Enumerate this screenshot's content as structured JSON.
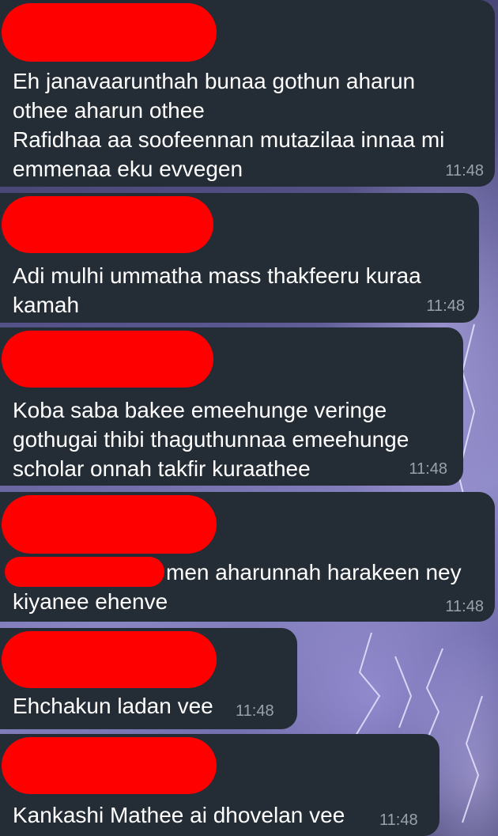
{
  "messages": [
    {
      "text": "Eh janavaarunthah bunaa gothun aharun\nothee aharun othee\nRafidhaa aa soofeennan mutazilaa innaa mi\nemmenaa eku evvegen",
      "time": "11:48"
    },
    {
      "text": "Adi mulhi ummatha mass thakfeeru kuraa\nkamah",
      "time": "11:48"
    },
    {
      "text": "Koba saba bakee emeehunge veringe\ngothugai thibi thaguthunnaa emeehunge\nscholar onnah takfir kuraathee",
      "time": "11:48"
    },
    {
      "text_after_redaction": "men aharunnah harakeen ney",
      "text": "kiyanee ehenve",
      "time": "11:48"
    },
    {
      "text": "Ehchakun ladan vee",
      "time": "11:48"
    },
    {
      "text": "Kankashi Mathee ai dhovelan vee",
      "time": "11:48"
    }
  ],
  "colors": {
    "bubble": "#242c35",
    "redaction": "#ff0000",
    "timestamp": "#9aa1a9"
  }
}
